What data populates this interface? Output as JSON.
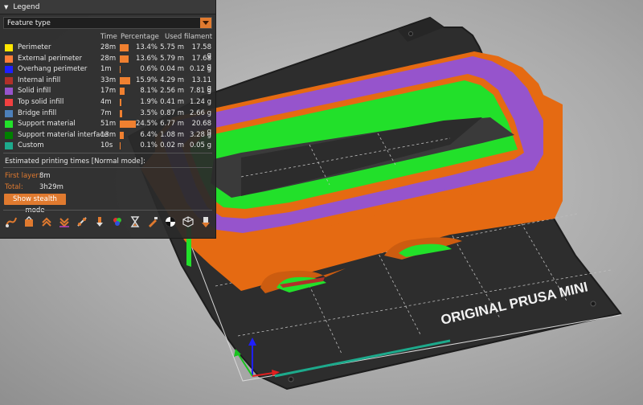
{
  "legend": {
    "title": "Legend",
    "view_type": "Feature type",
    "columns": {
      "time": "Time",
      "percentage": "Percentage",
      "filament": "Used filament"
    },
    "rows": [
      {
        "name": "Perimeter",
        "color": "#FFE600",
        "time": "28m",
        "percent": "13.4%",
        "length": "5.75 m",
        "weight": "17.58 g",
        "fraction": 0.134
      },
      {
        "name": "External perimeter",
        "color": "#FF7D38",
        "time": "28m",
        "percent": "13.6%",
        "length": "5.79 m",
        "weight": "17.68 g",
        "fraction": 0.136
      },
      {
        "name": "Overhang perimeter",
        "color": "#1F1FFF",
        "time": "1m",
        "percent": "0.6%",
        "length": "0.04 m",
        "weight": "0.12 g",
        "fraction": 0.006
      },
      {
        "name": "Internal infill",
        "color": "#B03029",
        "time": "33m",
        "percent": "15.9%",
        "length": "4.29 m",
        "weight": "13.11 g",
        "fraction": 0.159
      },
      {
        "name": "Solid infill",
        "color": "#9654CC",
        "time": "17m",
        "percent": "8.1%",
        "length": "2.56 m",
        "weight": "7.81 g",
        "fraction": 0.081
      },
      {
        "name": "Top solid infill",
        "color": "#F04040",
        "time": "4m",
        "percent": "1.9%",
        "length": "0.41 m",
        "weight": "1.24 g",
        "fraction": 0.019
      },
      {
        "name": "Bridge infill",
        "color": "#4D80BA",
        "time": "7m",
        "percent": "3.5%",
        "length": "0.87 m",
        "weight": "2.66 g",
        "fraction": 0.035
      },
      {
        "name": "Support material",
        "color": "#22E02A",
        "time": "51m",
        "percent": "24.5%",
        "length": "6.77 m",
        "weight": "20.68 g",
        "fraction": 0.245
      },
      {
        "name": "Support material interface",
        "color": "#008000",
        "time": "13m",
        "percent": "6.4%",
        "length": "1.08 m",
        "weight": "3.28 g",
        "fraction": 0.064
      },
      {
        "name": "Custom",
        "color": "#1DAA8C",
        "time": "10s",
        "percent": "0.1%",
        "length": "0.02 m",
        "weight": "0.05 g",
        "fraction": 0.001
      }
    ],
    "estimated_label": "Estimated printing times [Normal mode]:",
    "first_layer_label": "First layer:",
    "first_layer_value": "8m",
    "total_label": "Total:",
    "total_value": "3h29m",
    "stealth_button": "Show stealth mode",
    "toolbar_icons": [
      "travel-icon",
      "wipe-icon",
      "retractions-icon",
      "deretractions-icon",
      "seams-icon",
      "tool-changes-icon",
      "color-changes-icon",
      "pause-icon",
      "custom-gcode-icon",
      "center-of-gravity-icon",
      "shells-icon",
      "tool-marker-icon"
    ]
  },
  "bed": {
    "label": "ORIGINAL PRUSA MINI"
  },
  "colors": {
    "accent": "#E07A2F",
    "bed": "#2F2F2F"
  }
}
